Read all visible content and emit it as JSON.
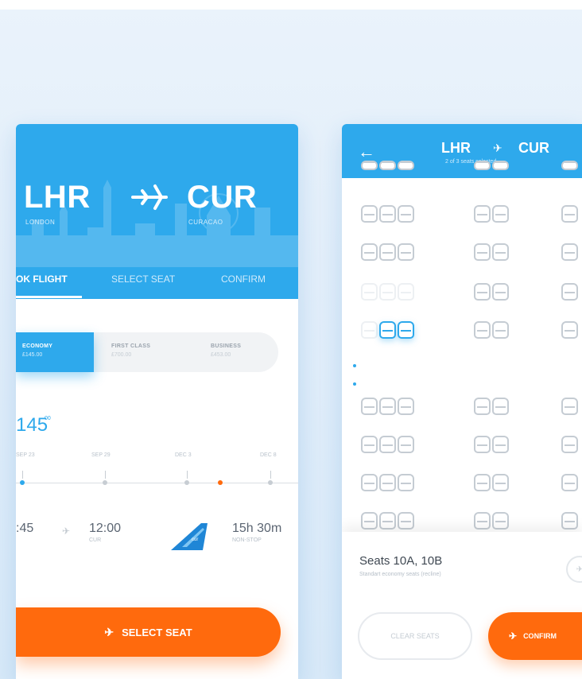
{
  "left_card": {
    "from_code": "LHR",
    "from_city": "LONDON",
    "to_code": "CUR",
    "to_city": "CURACAO",
    "tabs": [
      "OK FLIGHT",
      "SELECT SEAT",
      "CONFIRM"
    ],
    "classes": [
      {
        "name": "ECONOMY",
        "price": "£145.00"
      },
      {
        "name": "FIRST CLASS",
        "price": "£700.00"
      },
      {
        "name": "BUSINESS",
        "price": "£453.00"
      }
    ],
    "price": "145",
    "price_cents": "00",
    "dates": [
      "SEP 23",
      "SEP 29",
      "DEC 3",
      "DEC 8"
    ],
    "depart_time": ":45",
    "arrive_time": "12:00",
    "arrive_code": "CUR",
    "duration": "15h 30m",
    "duration_sub": "NON-STOP",
    "select_seat_btn": "SELECT SEAT"
  },
  "right_card": {
    "from_code": "LHR",
    "to_code": "CUR",
    "seat_count": "2 of 3 seats selected",
    "seats_title": "Seats 10A, 10B",
    "seats_sub": "Standart economy seats (recline)",
    "clear_btn": "CLEAR SEATS",
    "confirm_btn": "CONFIRM"
  },
  "colors": {
    "primary": "#2ea9ec",
    "accent": "#ff6a0d",
    "seat_border": "#c5ccd3"
  },
  "icons": [
    "plane-icon",
    "back-arrow-icon",
    "info-icon",
    "airline-tail-logo"
  ]
}
